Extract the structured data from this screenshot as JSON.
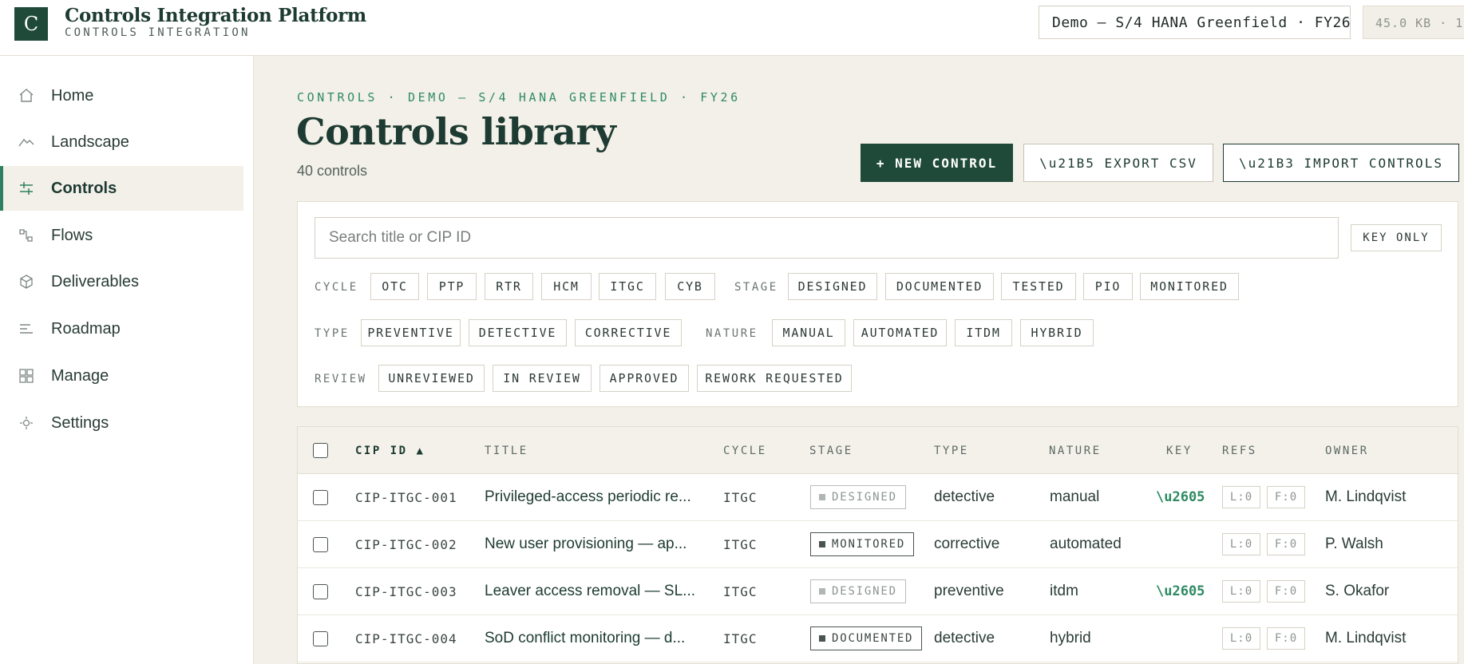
{
  "app": {
    "logo_letter": "C",
    "title": "Controls Integration Platform",
    "subtitle": "CONTROLS INTEGRATION",
    "environment": "Demo — S/4 HANA Greenfield · FY26",
    "size_badge": "45.0 KB · 1"
  },
  "sidebar": {
    "items": [
      {
        "label": "Home",
        "icon": "home-icon"
      },
      {
        "label": "Landscape",
        "icon": "landscape-icon"
      },
      {
        "label": "Controls",
        "icon": "sliders-icon",
        "active": true
      },
      {
        "label": "Flows",
        "icon": "flow-icon"
      },
      {
        "label": "Deliverables",
        "icon": "cube-icon"
      },
      {
        "label": "Roadmap",
        "icon": "roadmap-icon"
      },
      {
        "label": "Manage",
        "icon": "grid-icon"
      },
      {
        "label": "Settings",
        "icon": "settings-icon"
      }
    ]
  },
  "main": {
    "breadcrumb": "CONTROLS · DEMO — S/4 HANA GREENFIELD · FY26",
    "title": "Controls library",
    "count": "40 controls",
    "buttons": {
      "new": "+ NEW CONTROL",
      "export": "\\u21B5 EXPORT CSV",
      "import": "\\u21B3 IMPORT CONTROLS"
    }
  },
  "filters": {
    "search_placeholder": "Search title or CIP ID",
    "key_only": "KEY ONLY",
    "cycle_label": "CYCLE",
    "cycle": [
      "OTC",
      "PTP",
      "RTR",
      "HCM",
      "ITGC",
      "CYB"
    ],
    "stage_label": "STAGE",
    "stage": [
      "DESIGNED",
      "DOCUMENTED",
      "TESTED",
      "PIO",
      "MONITORED"
    ],
    "type_label": "TYPE",
    "type": [
      "PREVENTIVE",
      "DETECTIVE",
      "CORRECTIVE"
    ],
    "nature_label": "NATURE",
    "nature": [
      "MANUAL",
      "AUTOMATED",
      "ITDM",
      "HYBRID"
    ],
    "review_label": "REVIEW",
    "review": [
      "UNREVIEWED",
      "IN REVIEW",
      "APPROVED",
      "REWORK REQUESTED"
    ]
  },
  "table": {
    "headers": {
      "cip_id": "CIP ID ▲",
      "title": "TITLE",
      "cycle": "CYCLE",
      "stage": "STAGE",
      "type": "TYPE",
      "nature": "NATURE",
      "key": "KEY",
      "refs": "REFS",
      "owner": "OWNER"
    },
    "rows": [
      {
        "id": "CIP-ITGC-001",
        "title": "Privileged-access periodic re...",
        "cycle": "ITGC",
        "stage": "DESIGNED",
        "stage_style": "light",
        "type": "detective",
        "nature": "manual",
        "key": "\\u2605",
        "ref_l": "L:0",
        "ref_f": "F:0",
        "owner": "M. Lindqvist"
      },
      {
        "id": "CIP-ITGC-002",
        "title": "New user provisioning — ap...",
        "cycle": "ITGC",
        "stage": "MONITORED",
        "stage_style": "dark",
        "type": "corrective",
        "nature": "automated",
        "key": "",
        "ref_l": "L:0",
        "ref_f": "F:0",
        "owner": "P. Walsh"
      },
      {
        "id": "CIP-ITGC-003",
        "title": "Leaver access removal — SL...",
        "cycle": "ITGC",
        "stage": "DESIGNED",
        "stage_style": "light",
        "type": "preventive",
        "nature": "itdm",
        "key": "\\u2605",
        "ref_l": "L:0",
        "ref_f": "F:0",
        "owner": "S. Okafor"
      },
      {
        "id": "CIP-ITGC-004",
        "title": "SoD conflict monitoring — d...",
        "cycle": "ITGC",
        "stage": "DOCUMENTED",
        "stage_style": "dark",
        "type": "detective",
        "nature": "hybrid",
        "key": "",
        "ref_l": "L:0",
        "ref_f": "F:0",
        "owner": "M. Lindqvist"
      }
    ]
  }
}
